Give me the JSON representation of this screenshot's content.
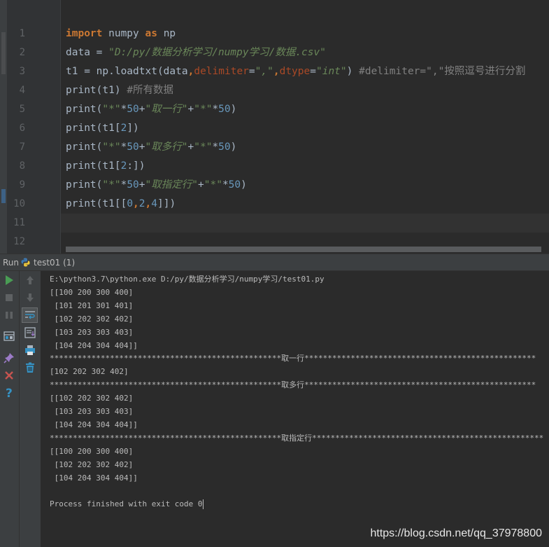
{
  "editor": {
    "line_numbers": [
      "1",
      "2",
      "3",
      "4",
      "5",
      "6",
      "7",
      "8",
      "9",
      "10",
      "11",
      "12"
    ],
    "lines": [
      [
        {
          "t": "import",
          "c": "kw"
        },
        {
          "t": " numpy ",
          "c": "p"
        },
        {
          "t": "as",
          "c": "kw"
        },
        {
          "t": " np",
          "c": "p"
        }
      ],
      [
        {
          "t": "data = ",
          "c": "p"
        },
        {
          "t": "\"D:/py/数据分析学习/numpy学习/数据.csv\"",
          "c": "str"
        }
      ],
      [
        {
          "t": "t1 = np.loadtxt(data",
          "c": "p"
        },
        {
          "t": ",",
          "c": "kw"
        },
        {
          "t": "delimiter",
          "c": "param"
        },
        {
          "t": "=",
          "c": "p"
        },
        {
          "t": "\",\"",
          "c": "str"
        },
        {
          "t": ",",
          "c": "kw"
        },
        {
          "t": "dtype",
          "c": "param"
        },
        {
          "t": "=",
          "c": "p"
        },
        {
          "t": "\"int\"",
          "c": "str"
        },
        {
          "t": ") ",
          "c": "p"
        },
        {
          "t": "#delimiter=\",\"按照逗号进行分割",
          "c": "cmt"
        }
      ],
      [
        {
          "t": "print",
          "c": "p"
        },
        {
          "t": "(t1) ",
          "c": "p"
        },
        {
          "t": "#所有数据",
          "c": "cmt"
        }
      ],
      [
        {
          "t": "print(",
          "c": "p"
        },
        {
          "t": "\"*\"",
          "c": "str"
        },
        {
          "t": "*",
          "c": "p"
        },
        {
          "t": "50",
          "c": "num"
        },
        {
          "t": "+",
          "c": "p"
        },
        {
          "t": "\"取一行\"",
          "c": "str"
        },
        {
          "t": "+",
          "c": "p"
        },
        {
          "t": "\"*\"",
          "c": "str"
        },
        {
          "t": "*",
          "c": "p"
        },
        {
          "t": "50",
          "c": "num"
        },
        {
          "t": ")",
          "c": "p"
        }
      ],
      [
        {
          "t": "print(t1[",
          "c": "p"
        },
        {
          "t": "2",
          "c": "num"
        },
        {
          "t": "])",
          "c": "p"
        }
      ],
      [
        {
          "t": "print(",
          "c": "p"
        },
        {
          "t": "\"*\"",
          "c": "str"
        },
        {
          "t": "*",
          "c": "p"
        },
        {
          "t": "50",
          "c": "num"
        },
        {
          "t": "+",
          "c": "p"
        },
        {
          "t": "\"取多行\"",
          "c": "str"
        },
        {
          "t": "+",
          "c": "p"
        },
        {
          "t": "\"*\"",
          "c": "str"
        },
        {
          "t": "*",
          "c": "p"
        },
        {
          "t": "50",
          "c": "num"
        },
        {
          "t": ")",
          "c": "p"
        }
      ],
      [
        {
          "t": "print(t1[",
          "c": "p"
        },
        {
          "t": "2",
          "c": "num"
        },
        {
          "t": ":])",
          "c": "p"
        }
      ],
      [
        {
          "t": "print(",
          "c": "p"
        },
        {
          "t": "\"*\"",
          "c": "str"
        },
        {
          "t": "*",
          "c": "p"
        },
        {
          "t": "50",
          "c": "num"
        },
        {
          "t": "+",
          "c": "p"
        },
        {
          "t": "\"取指定行\"",
          "c": "str"
        },
        {
          "t": "+",
          "c": "p"
        },
        {
          "t": "\"*\"",
          "c": "str"
        },
        {
          "t": "*",
          "c": "p"
        },
        {
          "t": "50",
          "c": "num"
        },
        {
          "t": ")",
          "c": "p"
        }
      ],
      [
        {
          "t": "print(t1[[",
          "c": "p"
        },
        {
          "t": "0",
          "c": "num"
        },
        {
          "t": ",",
          "c": "kw"
        },
        {
          "t": "2",
          "c": "num"
        },
        {
          "t": ",",
          "c": "kw"
        },
        {
          "t": "4",
          "c": "num"
        },
        {
          "t": "]])",
          "c": "p"
        }
      ],
      [],
      []
    ]
  },
  "run_panel": {
    "label": "Run",
    "tab_label": "test01 (1)",
    "tab_icon": "python-icon"
  },
  "toolbar_left": [
    "run-icon",
    "stop-icon",
    "pause-icon",
    "layout-icon",
    "pin-icon",
    "close-icon",
    "help-icon"
  ],
  "toolbar_right": [
    "up-arrow-icon",
    "down-arrow-icon",
    "soft-wrap-icon",
    "scroll-to-end-icon",
    "print-icon",
    "trash-icon"
  ],
  "colors": {
    "keyword": "#cc7832",
    "string": "#6a8759",
    "number": "#6897bb",
    "comment": "#808080",
    "param": "#aa4926",
    "run_green": "#499c54",
    "close_red": "#c75450",
    "help_blue": "#3592c4"
  },
  "console": {
    "lines": [
      "E:\\python3.7\\python.exe D:/py/数据分析学习/numpy学习/test01.py",
      "[[100 200 300 400]",
      " [101 201 301 401]",
      " [102 202 302 402]",
      " [103 203 303 403]",
      " [104 204 304 404]]",
      "**************************************************取一行**************************************************",
      "[102 202 302 402]",
      "**************************************************取多行**************************************************",
      "[[102 202 302 402]",
      " [103 203 303 403]",
      " [104 204 304 404]]",
      "**************************************************取指定行**************************************************",
      "[[100 200 300 400]",
      " [102 202 302 402]",
      " [104 204 304 404]]",
      "",
      "Process finished with exit code 0"
    ]
  },
  "watermark": "https://blog.csdn.net/qq_37978800"
}
